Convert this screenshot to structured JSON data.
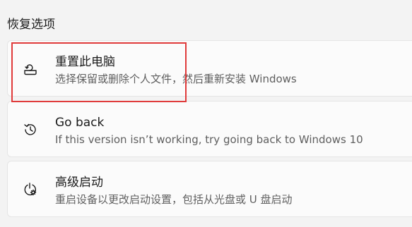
{
  "section": {
    "title": "恢复选项"
  },
  "options": [
    {
      "title": "重置此电脑",
      "description": "选择保留或删除个人文件，然后重新安装 Windows",
      "icon": "reset-pc-icon"
    },
    {
      "title": "Go back",
      "description": "If this version isn’t working, try going back to Windows 10",
      "icon": "history-icon"
    },
    {
      "title": "高级启动",
      "description": "重启设备以更改启动设置，包括从光盘或 U 盘启动",
      "icon": "advanced-startup-icon"
    }
  ],
  "colors": {
    "highlight": "#e03b3b",
    "card_background": "#fbfbfb",
    "page_background": "#f3f3f3"
  }
}
